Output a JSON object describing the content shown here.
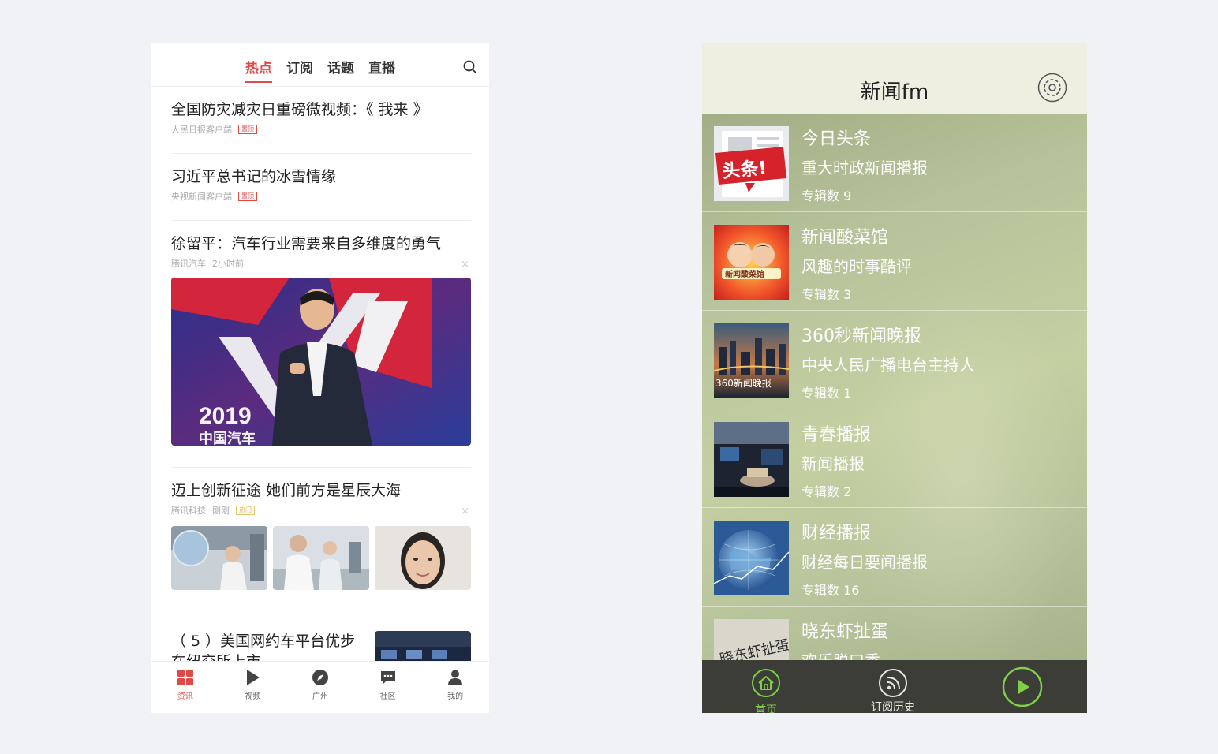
{
  "news_app": {
    "tabs": [
      {
        "label": "热点",
        "active": true
      },
      {
        "label": "订阅",
        "active": false
      },
      {
        "label": "话题",
        "active": false
      },
      {
        "label": "直播",
        "active": false
      }
    ],
    "articles": [
      {
        "title": "全国防灾减灾日重磅微视频：《 我来 》",
        "source": "人民日报客户端",
        "badge": "置顶"
      },
      {
        "title": "习近平总书记的冰雪情缘",
        "source": "央视新闻客户端",
        "badge": "置顶"
      },
      {
        "title": "徐留平：汽车行业需要来自多维度的勇气",
        "source": "腾讯汽车",
        "time": "2小时前",
        "close": "×"
      },
      {
        "title": "迈上创新征途 她们前方是星辰大海",
        "source": "腾讯科技",
        "time": "刚刚",
        "badge": "热门",
        "close": "×"
      },
      {
        "title": "（ 5 ）美国网约车平台优步",
        "title2": "在纽交所上市"
      }
    ],
    "bottom_nav": [
      {
        "label": "资讯",
        "icon": "grid-icon",
        "active": true
      },
      {
        "label": "视频",
        "icon": "play-icon",
        "active": false
      },
      {
        "label": "广州",
        "icon": "compass-icon",
        "active": false
      },
      {
        "label": "社区",
        "icon": "chat-icon",
        "active": false
      },
      {
        "label": "我的",
        "icon": "user-icon",
        "active": false
      }
    ],
    "accent_color": "#e04a46"
  },
  "fm_app": {
    "title": "新闻fm",
    "channels": [
      {
        "name": "今日头条",
        "desc": "重大时政新闻播报",
        "count": "专辑数 9",
        "thumb_text": "头条!"
      },
      {
        "name": "新闻酸菜馆",
        "desc": "风趣的时事酷评",
        "count": "专辑数 3",
        "thumb_text": "新闻酸菜馆"
      },
      {
        "name": "360秒新闻晚报",
        "desc": "中央人民广播电台主持人",
        "count": "专辑数 1",
        "thumb_text": "360新闻晚报"
      },
      {
        "name": "青春播报",
        "desc": "新闻播报",
        "count": "专辑数 2"
      },
      {
        "name": "财经播报",
        "desc": "财经每日要闻播报",
        "count": "专辑数 16"
      },
      {
        "name": "晓东虾扯蛋",
        "desc": "欢乐脱口秀",
        "thumb_text": "晓东虾扯蛋"
      }
    ],
    "bottom_nav": [
      {
        "label": "首页",
        "icon": "home-icon",
        "active": true
      },
      {
        "label": "订阅历史",
        "icon": "rss-icon",
        "active": false
      }
    ],
    "accent_color": "#7ed04b"
  }
}
